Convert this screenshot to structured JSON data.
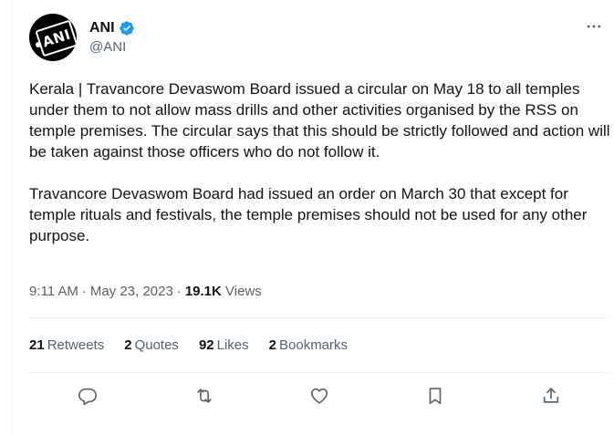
{
  "author": {
    "display_name": "ANI",
    "handle": "@ANI",
    "avatar_logo_text": "ANI",
    "verified": true
  },
  "tweet": {
    "text": "Kerala | Travancore Devaswom Board issued a circular on May 18 to all temples under them to not allow mass drills and other activities organised by the RSS on temple premises. The circular says that this should be strictly followed and action will be taken against those officers who do not follow it.\n\nTravancore Devaswom Board had issued an order on March 30 that except for temple rituals and festivals, the temple premises should not be used for any other purpose.",
    "time": "9:11 AM",
    "date": "May 23, 2023",
    "separator": "·",
    "views_count": "19.1K",
    "views_label": "Views"
  },
  "stats": {
    "retweets_count": "21",
    "retweets_label": "Retweets",
    "quotes_count": "2",
    "quotes_label": "Quotes",
    "likes_count": "92",
    "likes_label": "Likes",
    "bookmarks_count": "2",
    "bookmarks_label": "Bookmarks"
  },
  "icons": {
    "more": "more-horizontal-icon",
    "verified": "verified-badge-icon",
    "reply": "reply-icon",
    "retweet": "retweet-icon",
    "like": "heart-icon",
    "bookmark": "bookmark-icon",
    "share": "share-icon"
  },
  "colors": {
    "text_primary": "#0f1419",
    "text_secondary": "#536471",
    "verified_blue": "#1d9bf0",
    "divider": "#eff3f4"
  }
}
